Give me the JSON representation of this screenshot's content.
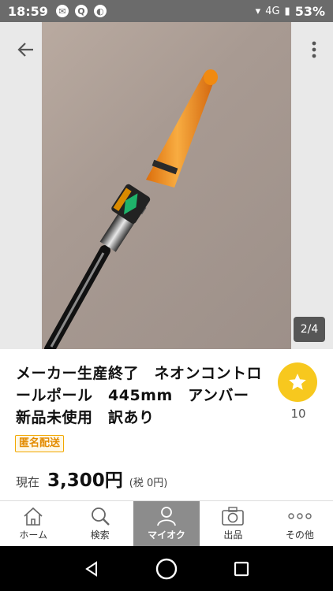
{
  "status": {
    "time": "18:59",
    "network": "4G",
    "battery": "53%"
  },
  "gallery": {
    "counter": "2/4"
  },
  "item": {
    "title": "メーカー生産終了　ネオンコントロールポール　445mm　アンバー　新品未使用　訳あり",
    "watch_count": "10",
    "badge": "匿名配送",
    "price_label": "現在",
    "price": "3,300円",
    "tax": "(税 0円)"
  },
  "tabs": [
    {
      "label": "ホーム",
      "icon": "home-icon"
    },
    {
      "label": "検索",
      "icon": "search-icon"
    },
    {
      "label": "マイオク",
      "icon": "person-icon",
      "active": true
    },
    {
      "label": "出品",
      "icon": "camera-icon"
    },
    {
      "label": "その他",
      "icon": "more-icon"
    }
  ],
  "colors": {
    "accent": "#f7c81e",
    "badge": "#f2a800",
    "statusbar": "#6b6b6b"
  }
}
